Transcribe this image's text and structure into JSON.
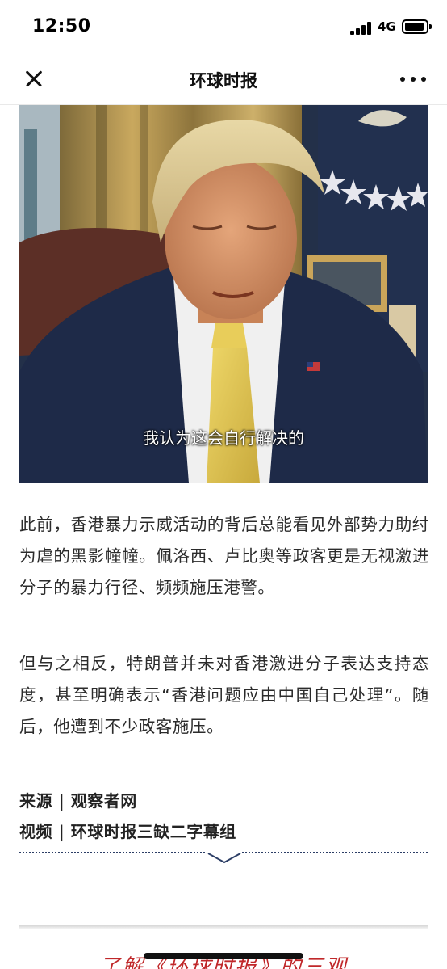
{
  "status_bar": {
    "time": "12:50",
    "network": "4G"
  },
  "nav": {
    "title": "环球时报"
  },
  "video": {
    "subtitle": "我认为这会自行解决的"
  },
  "article": {
    "paragraphs": [
      "此前，香港暴力示威活动的背后总能看见外部势力助纣为虐的黑影幢幢。佩洛西、卢比奥等政客更是无视激进分子的暴力行径、频频施压港警。",
      "但与之相反，特朗普并未对香港激进分子表达支持态度，甚至明确表示“香港问题应由中国自己处理”。随后，他遭到不少政客施压。"
    ],
    "source": "来源 | 观察者网",
    "video_credit": "视频 | 环球时报三缺二字幕组"
  },
  "footer": {
    "teaser": "了解《环球时报》的三观"
  },
  "colors": {
    "accent_red": "#c0282a",
    "divider_navy": "#2c3e66"
  }
}
